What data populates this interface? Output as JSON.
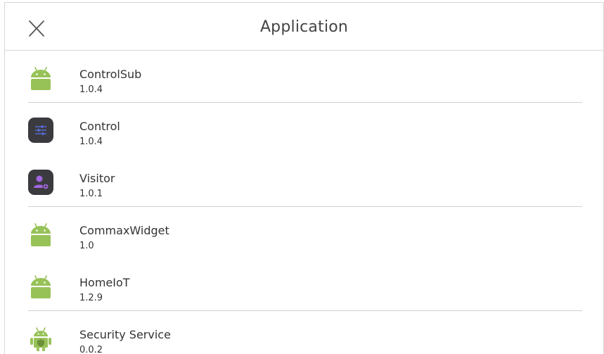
{
  "header": {
    "title": "Application",
    "close_icon": "close-icon"
  },
  "apps": [
    {
      "name": "ControlSub",
      "version": "1.0.4",
      "icon": "android-icon",
      "divider": true
    },
    {
      "name": "Control",
      "version": "1.0.4",
      "icon": "sliders-icon",
      "divider": false
    },
    {
      "name": "Visitor",
      "version": "1.0.1",
      "icon": "visitor-icon",
      "divider": true
    },
    {
      "name": "CommaxWidget",
      "version": "1.0",
      "icon": "android-icon",
      "divider": false
    },
    {
      "name": "HomeIoT",
      "version": "1.2.9",
      "icon": "android-icon",
      "divider": true
    },
    {
      "name": "Security Service",
      "version": "0.0.2",
      "icon": "android-shield-icon",
      "divider": false
    }
  ],
  "colors": {
    "android_green": "#97c258",
    "dark_tile": "#3b3b3f",
    "control_accent": "#5b6ee1",
    "visitor_accent": "#a366e0",
    "divider": "#cfcfcf"
  }
}
